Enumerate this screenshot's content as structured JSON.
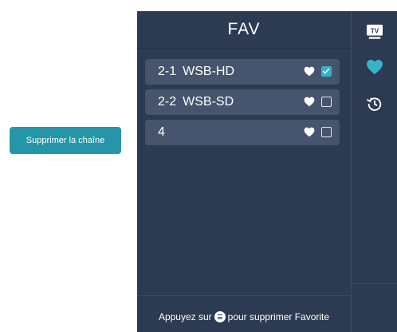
{
  "actions": {
    "remove_channel_label": "Supprimer la chaîne"
  },
  "panel": {
    "title": "FAV",
    "hint_before": "Appuyez sur",
    "hint_after": "pour supprimer Favorite",
    "channels": [
      {
        "number": "2-1",
        "name": "WSB-HD",
        "favorite": true,
        "checked": true
      },
      {
        "number": "2-2",
        "name": "WSB-SD",
        "favorite": true,
        "checked": false
      },
      {
        "number": "4",
        "name": "",
        "favorite": true,
        "checked": false
      }
    ]
  },
  "side_menu": {
    "tv_icon_text": "TV",
    "items": [
      "tv-icon",
      "heart-icon",
      "history-icon"
    ],
    "active_color": "#37b2c6"
  },
  "colors": {
    "panel_bg": "#2c3a52",
    "row_bg": "#46556d",
    "accent": "#37b2c6",
    "button_bg": "#2596a8"
  }
}
